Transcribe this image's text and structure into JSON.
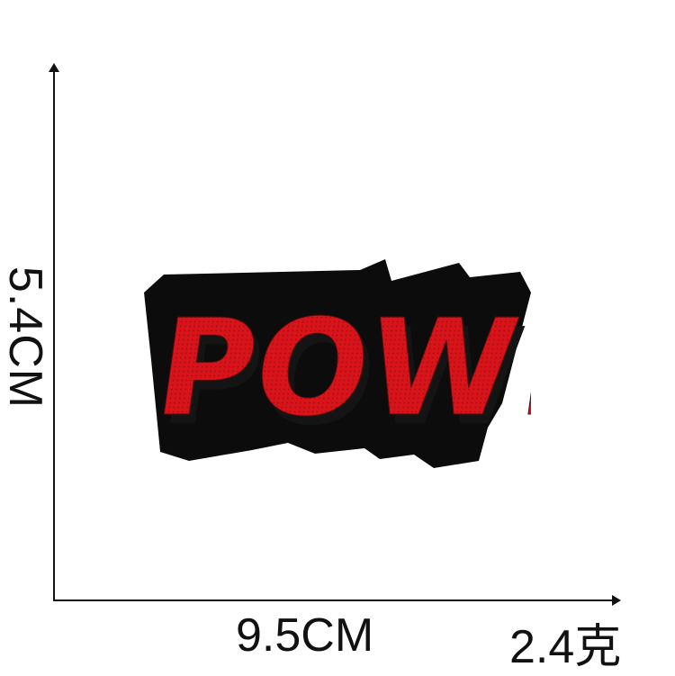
{
  "dimensions": {
    "height_label": "5.4CM",
    "width_label": "9.5CM",
    "weight_label": "2.4克"
  },
  "patch": {
    "text": "POW!",
    "colors": {
      "fill": "#d8141a",
      "border": "#0c0c0c",
      "shadow": "#141414"
    }
  }
}
